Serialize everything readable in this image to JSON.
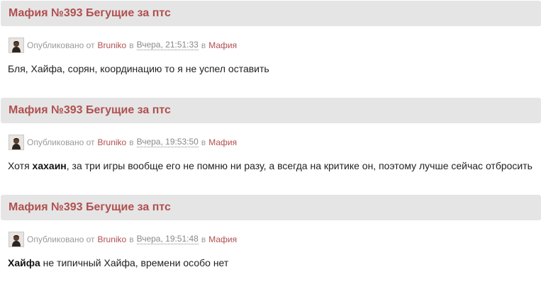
{
  "posts": [
    {
      "title": "Мафия №393 Бегущие за птс",
      "published_text": "Опубликовано от",
      "author": "Bruniko",
      "in_text": "в",
      "date": "Вчера, 21:51:33",
      "in_text_2": "в",
      "category": "Мафия",
      "body_bold": "",
      "body_before": "",
      "body_after": "Бля, Хайфа, сорян, координацию то я не успел оставить"
    },
    {
      "title": "Мафия №393 Бегущие за птс",
      "published_text": "Опубликовано от",
      "author": "Bruniko",
      "in_text": "в",
      "date": "Вчера, 19:53:50",
      "in_text_2": "в",
      "category": "Мафия",
      "body_before": "Хотя ",
      "body_bold": "хахаин",
      "body_after": ", за три игры вообще его не помню ни разу, а всегда на критике он, поэтому лучше сейчас отбросить"
    },
    {
      "title": "Мафия №393 Бегущие за птс",
      "published_text": "Опубликовано от",
      "author": "Bruniko",
      "in_text": "в",
      "date": "Вчера, 19:51:48",
      "in_text_2": "в",
      "category": "Мафия",
      "body_before": "",
      "body_bold": "Хайфа",
      "body_after": " не типичный Хайфа, времени особо нет"
    }
  ],
  "colors": {
    "accent": "#b14f4f",
    "header_bg": "#e5e5e5",
    "meta_text": "#9a9a9a"
  },
  "icons": {
    "avatar": "user-avatar-icon"
  }
}
